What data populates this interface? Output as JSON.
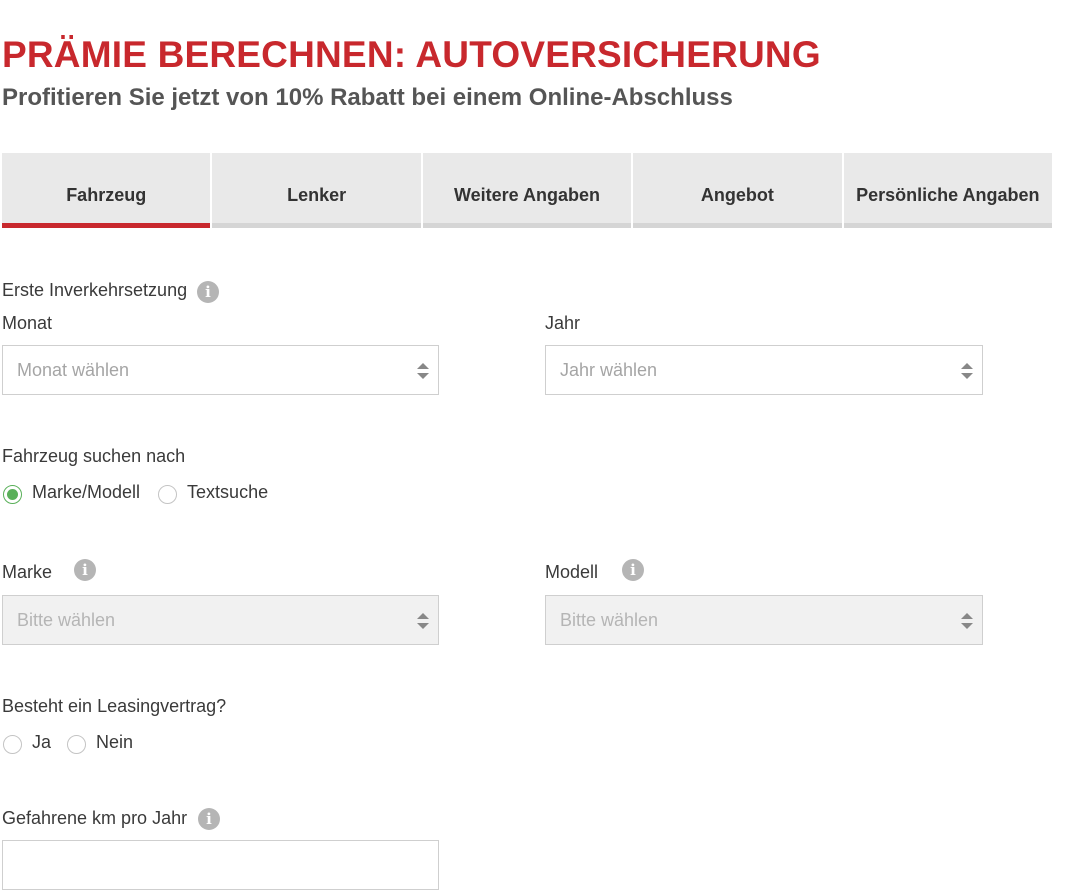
{
  "header": {
    "title": "PRÄMIE BERECHNEN: AUTOVERSICHERUNG",
    "subtitle": "Profitieren Sie jetzt von 10% Rabatt bei einem Online-Abschluss"
  },
  "tabs": [
    {
      "label": "Fahrzeug",
      "active": true
    },
    {
      "label": "Lenker"
    },
    {
      "label": "Weitere Angaben"
    },
    {
      "label": "Angebot"
    },
    {
      "label": "Persönliche Angaben"
    }
  ],
  "form": {
    "first_registration": {
      "label": "Erste Inverkehrsetzung",
      "month": {
        "label": "Monat",
        "placeholder": "Monat wählen"
      },
      "year": {
        "label": "Jahr",
        "placeholder": "Jahr wählen"
      }
    },
    "search_by": {
      "label": "Fahrzeug suchen nach",
      "options": [
        "Marke/Modell",
        "Textsuche"
      ],
      "selected": "Marke/Modell"
    },
    "brand": {
      "label": "Marke",
      "placeholder": "Bitte wählen"
    },
    "model": {
      "label": "Modell",
      "placeholder": "Bitte wählen"
    },
    "leasing": {
      "label": "Besteht ein Leasingvertrag?",
      "options": [
        "Ja",
        "Nein"
      ]
    },
    "km_per_year": {
      "label": "Gefahrene km pro Jahr"
    }
  },
  "colors": {
    "accent": "#c8282d",
    "radio_selected": "#5ab05a",
    "info_icon": "#b5b5b5"
  },
  "icons": {
    "info": "i"
  }
}
